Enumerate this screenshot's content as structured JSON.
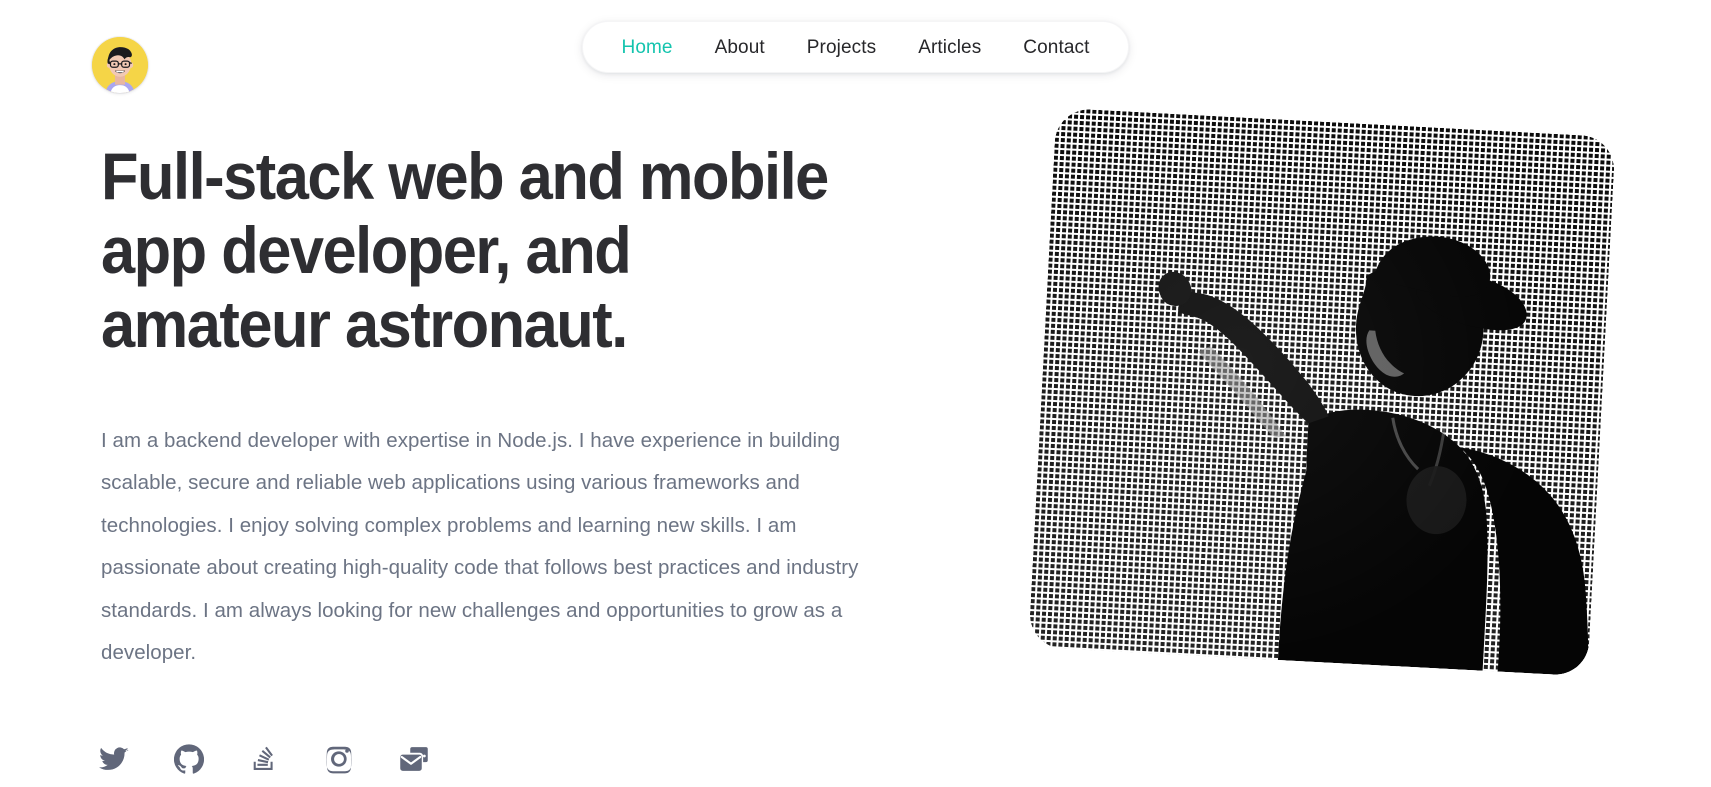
{
  "site": {
    "background_color": "#ffffff",
    "accent_color": "#14c4ae",
    "heading_color": "#2e2e32",
    "body_text_color": "#6c7484",
    "icon_color": "#61677a"
  },
  "avatar": {
    "name": "avatar",
    "alt": "Cartoon portrait avatar of the site owner",
    "background_color": "#f5d547",
    "hair_color": "#1b1b1f",
    "skin_color": "#f2c9b4",
    "shirt_color": "#a9a6f0"
  },
  "nav": {
    "items": [
      {
        "label": "Home",
        "active": true
      },
      {
        "label": "About",
        "active": false
      },
      {
        "label": "Projects",
        "active": false
      },
      {
        "label": "Articles",
        "active": false
      },
      {
        "label": "Contact",
        "active": false
      }
    ]
  },
  "hero": {
    "title": "Full-stack web and mobile app developer, and amateur astronaut.",
    "body": "I am a backend developer with expertise in Node.js. I have experience in building scalable, secure and reliable web applications using various frameworks and technologies. I enjoy solving complex problems and learning new skills. I am passionate about creating high-quality code that follows best practices and industry standards. I am always looking for new challenges and opportunities to grow as a developer.",
    "photo": {
      "alt": "Black and white halftone photo of a person wearing a cap with one arm raised",
      "style": "halftone dot pattern, rotated, rounded corners"
    }
  },
  "socials": [
    {
      "name": "twitter-icon",
      "label": "Follow on Twitter"
    },
    {
      "name": "github-icon",
      "label": "Follow on GitHub"
    },
    {
      "name": "stack-overflow-icon",
      "label": "Follow on Stack Overflow"
    },
    {
      "name": "instagram-icon",
      "label": "Follow on Instagram"
    },
    {
      "name": "mail-icon",
      "label": "Subscribe by email"
    }
  ]
}
